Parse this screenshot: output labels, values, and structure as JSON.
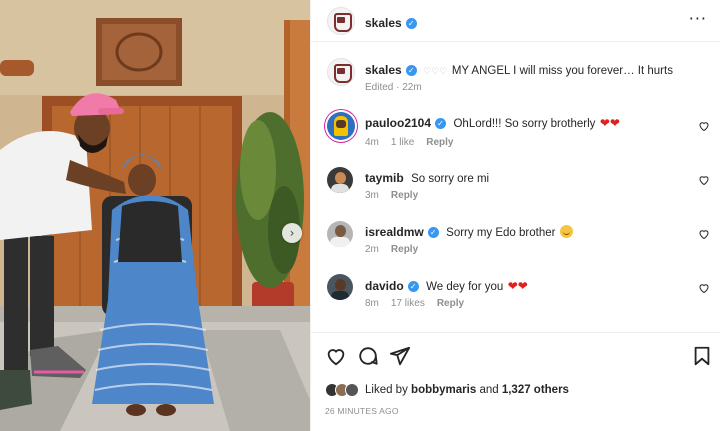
{
  "post": {
    "author": "skales",
    "author_verified": true,
    "more_icon": "more-horizontal-icon"
  },
  "caption": {
    "username": "skales",
    "prefix": "♡♡♡",
    "text": "MY ANGEL I will miss you forever… It hurts",
    "meta": "Edited · 22m"
  },
  "comments": [
    {
      "username": "pauloo2104",
      "verified": true,
      "text": "OhLord!!! So sorry brotherly",
      "emoji": "❤❤",
      "time": "4m",
      "likes": "1 like",
      "reply": "Reply",
      "avatar_color": "#2e6fbf"
    },
    {
      "username": "taymib",
      "verified": false,
      "text": "So sorry ore mi",
      "emoji": "",
      "time": "3m",
      "likes": "",
      "reply": "Reply",
      "avatar_color": "#3a3a3a"
    },
    {
      "username": "isrealdmw",
      "verified": true,
      "text": "Sorry my Edo brother",
      "emoji": "smile",
      "time": "2m",
      "likes": "",
      "reply": "Reply",
      "avatar_color": "#9a9a9a"
    },
    {
      "username": "davido",
      "verified": true,
      "text": "We dey for you",
      "emoji": "❤❤",
      "time": "8m",
      "likes": "17 likes",
      "reply": "Reply",
      "avatar_color": "#4a5560"
    }
  ],
  "actions": {
    "like_icon": "heart-icon",
    "comment_icon": "comment-icon",
    "share_icon": "share-icon",
    "save_icon": "bookmark-icon"
  },
  "likes": {
    "prefix": "Liked by",
    "user": "bobbymaris",
    "conjunction": "and",
    "count": "1,327 others"
  },
  "timestamp": "26 MINUTES AGO",
  "colors": {
    "verified": "#3897f0",
    "secondary_text": "#8e8e8e",
    "heart": "#e0201f"
  }
}
